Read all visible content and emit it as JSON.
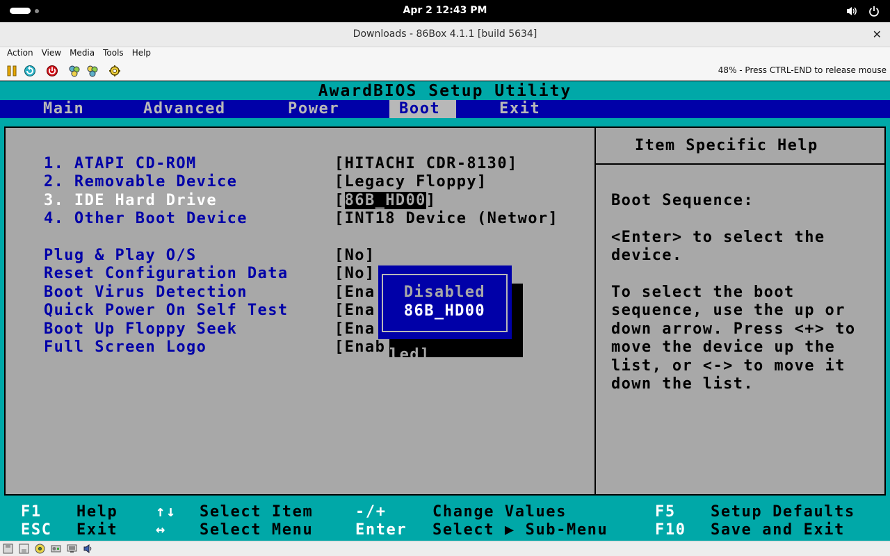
{
  "system": {
    "clock": "Apr 2  12:43 PM",
    "icons": [
      "activities-pill",
      "volume-icon",
      "power-icon"
    ]
  },
  "window": {
    "title": "Downloads - 86Box 4.1.1 [build 5634]",
    "close": "✕"
  },
  "menu": [
    "Action",
    "View",
    "Media",
    "Tools",
    "Help"
  ],
  "toolbar": {
    "icons": [
      "pause-icon",
      "reset-icon",
      "power-off-icon",
      "ctrl-alt-del-icon",
      "ctrl-alt-esc-icon",
      "settings-icon"
    ],
    "status": "48% - Press CTRL-END to release mouse"
  },
  "bios": {
    "title": "AwardBIOS Setup Utility",
    "tabs": [
      "Main",
      "Advanced",
      "Power",
      "Boot",
      "Exit"
    ],
    "active_tab": "Boot",
    "items": [
      {
        "label": "1. ATAPI CD-ROM",
        "value": "[HITACHI CDR-8130]"
      },
      {
        "label": "2. Removable Device",
        "value": "[Legacy Floppy]"
      },
      {
        "label": "3. IDE Hard Drive",
        "value_open": "[",
        "value_hl": "86B_HD00",
        "value_close": "]",
        "selected": true
      },
      {
        "label": "4. Other Boot Device",
        "value": "[INT18 Device (Networ]"
      },
      {
        "label": "Plug & Play O/S",
        "value": "[No]"
      },
      {
        "label": "Reset Configuration Data",
        "value": "[No]"
      },
      {
        "label": "Boot Virus Detection",
        "value": "[Ena"
      },
      {
        "label": "Quick Power On Self Test",
        "value": "[Ena"
      },
      {
        "label": "Boot Up Floppy Seek",
        "value": "[Ena"
      },
      {
        "label": "Full Screen Logo",
        "value": "[Enabled]",
        "value_visible": "[Enab",
        "value_shadowed": "led]"
      }
    ],
    "help": {
      "title": "Item Specific Help",
      "lines": [
        "Boot Sequence:",
        "",
        "<Enter> to select the",
        "device.",
        "",
        "To select the boot",
        "sequence, use the up or",
        "down arrow. Press <+> to",
        "move the device up the",
        "list, or <-> to move it",
        "down the list."
      ]
    },
    "popup": {
      "options": [
        "Disabled",
        "86B_HD00"
      ],
      "selected": "86B_HD00"
    },
    "footer": [
      [
        {
          "key": "F1",
          "desc": "Help"
        },
        {
          "key": "↑↓",
          "desc": "Select Item"
        },
        {
          "key": "-/+",
          "desc": "Change Values"
        },
        {
          "key": "F5",
          "desc": "Setup Defaults"
        }
      ],
      [
        {
          "key": "ESC",
          "desc": "Exit"
        },
        {
          "key": "↔",
          "desc": "Select Menu"
        },
        {
          "key": "Enter",
          "desc": "Select ▶ Sub-Menu"
        },
        {
          "key": "F10",
          "desc": "Save and Exit"
        }
      ]
    ]
  },
  "statusbar": {
    "icons": [
      "floppy-icon",
      "floppy-2-icon",
      "cdrom-icon",
      "hdd-icon",
      "network-icon",
      "sound-icon"
    ]
  }
}
